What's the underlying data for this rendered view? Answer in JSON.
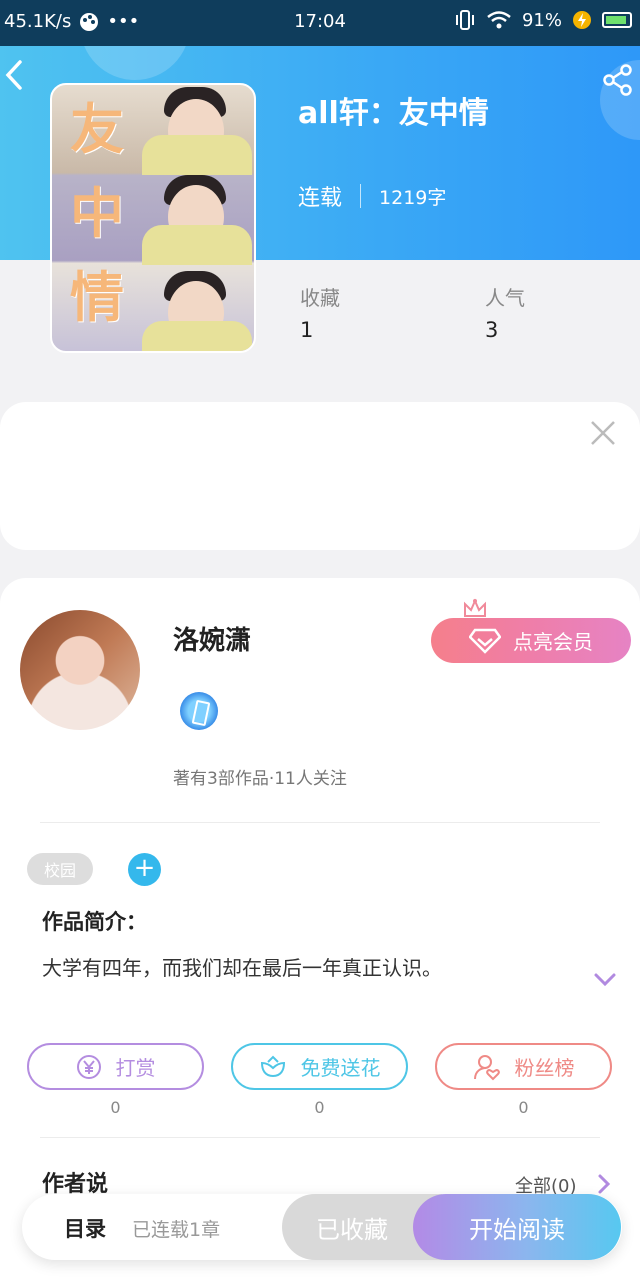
{
  "status_bar": {
    "net_speed": "45.1K/s",
    "dots": "•••",
    "time": "17:04",
    "battery": "91%"
  },
  "book": {
    "title": "all轩：友中情",
    "status": "连载",
    "word_count": "1219字",
    "cover_chars": [
      "友",
      "中",
      "情"
    ],
    "stats": [
      {
        "label": "收藏",
        "value": "1"
      },
      {
        "label": "人气",
        "value": "3"
      }
    ]
  },
  "author": {
    "name": "洛婉潇",
    "info": "著有3部作品·11人关注",
    "vip_button": "点亮会员"
  },
  "tags": {
    "items": [
      "校园"
    ],
    "add": "+"
  },
  "intro": {
    "heading": "作品简介：",
    "text": "大学有四年，而我们却在最后一年真正认识。"
  },
  "actions": [
    {
      "label": "打赏",
      "count": "0",
      "color": "#b48de0",
      "icon": "yen-coin-icon"
    },
    {
      "label": "免费送花",
      "count": "0",
      "color": "#4ec6e6",
      "icon": "flower-icon"
    },
    {
      "label": "粉丝榜",
      "count": "0",
      "color": "#ef8a86",
      "icon": "fan-user-icon"
    }
  ],
  "author_says": {
    "heading": "作者说",
    "all_link": "全部(0)"
  },
  "bottom_bar": {
    "toc_label": "目录",
    "toc_sub": "已连载1章",
    "collected": "已收藏",
    "read": "开始阅读"
  }
}
